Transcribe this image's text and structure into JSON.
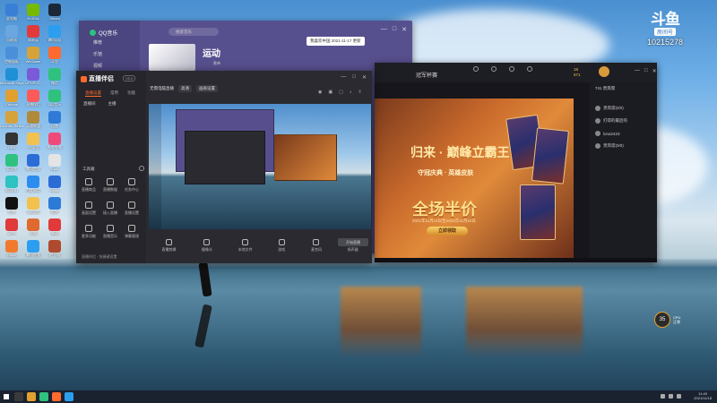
{
  "desktop": {
    "icons": [
      {
        "label": "此电脑",
        "color": "#3a7fd6"
      },
      {
        "label": "NVIDIA",
        "color": "#76b900"
      },
      {
        "label": "Steam",
        "color": "#1b2838"
      },
      {
        "label": "回收站",
        "color": "#6aa6e0"
      },
      {
        "label": "网易云",
        "color": "#e23a3a"
      },
      {
        "label": "腾讯QQ",
        "color": "#2c9ef0"
      },
      {
        "label": "控制面板",
        "color": "#4a90d9"
      },
      {
        "label": "WeGame",
        "color": "#d6a23a"
      },
      {
        "label": "斗鱼",
        "color": "#ff6a2e"
      },
      {
        "label": "Microsoft Edge",
        "color": "#1f8fd6"
      },
      {
        "label": "UPUPOO",
        "color": "#7a5ad6"
      },
      {
        "label": "微信",
        "color": "#2ec27e"
      },
      {
        "label": "Chrome",
        "color": "#e0a030"
      },
      {
        "label": "直播伴侣",
        "color": "#ff5a5a"
      },
      {
        "label": "QQ音乐",
        "color": "#2ec27e"
      },
      {
        "label": "Counter-Strike",
        "color": "#d6a23a"
      },
      {
        "label": "英雄联盟",
        "color": "#b08a3a"
      },
      {
        "label": "迅雷",
        "color": "#2e7ad6"
      },
      {
        "label": "OBS",
        "color": "#333333"
      },
      {
        "label": "YY语音",
        "color": "#f2c14e"
      },
      {
        "label": "哔哩哔哩",
        "color": "#f04a7a"
      },
      {
        "label": "爱奇艺",
        "color": "#2ec27e"
      },
      {
        "label": "腾讯会议",
        "color": "#2c6cd6"
      },
      {
        "label": "Epic",
        "color": "#e4e4e4"
      },
      {
        "label": "网易UU",
        "color": "#2ec2c2"
      },
      {
        "label": "百度网盘",
        "color": "#2c8cf0"
      },
      {
        "label": "Uplay",
        "color": "#2c6cd6"
      },
      {
        "label": "剪映",
        "color": "#111111"
      },
      {
        "label": "QQ游戏",
        "color": "#f2c14e"
      },
      {
        "label": "酷狗",
        "color": "#2c7ad6"
      },
      {
        "label": "WPS",
        "color": "#e03a3a"
      },
      {
        "label": "火绒",
        "color": "#e06a2e"
      },
      {
        "label": "有道",
        "color": "#e03a3a"
      },
      {
        "label": "Origin",
        "color": "#f27a2e"
      },
      {
        "label": "腾讯视频",
        "color": "#2c9ef0"
      },
      {
        "label": "地下城",
        "color": "#b04a2e"
      }
    ]
  },
  "douyu": {
    "logo": "斗鱼",
    "room_tag": "房间号",
    "room_number": "10215278"
  },
  "qqmusic": {
    "brand": "QQ音乐",
    "nav": [
      "推荐",
      "乐馆",
      "视频"
    ],
    "search_placeholder": "搜索音乐",
    "title": "运动",
    "subtitle": "歌单",
    "tooltip": "我喜欢中国 2021-11-17 更新",
    "controls": [
      "—",
      "□",
      "✕"
    ]
  },
  "streamer": {
    "app_name": "直播伴侣",
    "version": "V5.0",
    "tabs": [
      "直播设置",
      "常用",
      "功能"
    ],
    "header_chips": [
      "无需电脑直播",
      "高清",
      "画质设置"
    ],
    "tools_top": [
      {
        "label": "直播间"
      },
      {
        "label": "主播"
      }
    ],
    "section_label": "工具箱",
    "tools": [
      {
        "label": "直播商品"
      },
      {
        "label": "直播数据"
      },
      {
        "label": "任务中心"
      },
      {
        "label": "画面设置"
      },
      {
        "label": "接入直播"
      },
      {
        "label": "直播设置"
      },
      {
        "label": "更多功能"
      },
      {
        "label": "直播音乐"
      },
      {
        "label": "弹幕管理"
      }
    ],
    "bottom_tools": [
      {
        "label": "直播剪辑"
      },
      {
        "label": "摄像头"
      },
      {
        "label": "本地文件"
      },
      {
        "label": "游戏"
      },
      {
        "label": "麦克风"
      },
      {
        "label": "扬声器"
      }
    ],
    "footer": "直播伴侣 · 快捷键设置",
    "go_live": "开始直播",
    "controls": [
      "—",
      "□",
      "✕"
    ]
  },
  "gamewin": {
    "title": "冠军杯赛",
    "counts_line1": "18",
    "counts_line2": "571",
    "banner_deco": "归来 · 巅峰立霸王",
    "banner_tagline": "守冠庆典 · 英雄皮肤",
    "banner_headline": "全场半价",
    "banner_date": "2021年11月12日至2021年11月22日",
    "cta": "立即领取",
    "sidebar_title": "741 贵宾席",
    "ranks": [
      {
        "name": "贵宾席(0/0)"
      },
      {
        "name": "打得的最后的"
      },
      {
        "name": "luna2423"
      },
      {
        "name": "贵宾席(0/0)"
      }
    ],
    "controls": [
      "—",
      "□",
      "✕"
    ]
  },
  "widget": {
    "value": "35",
    "line1": "CPU",
    "line2": "正常"
  },
  "taskbar": {
    "time": "11:40",
    "date": "2021/11/18"
  }
}
